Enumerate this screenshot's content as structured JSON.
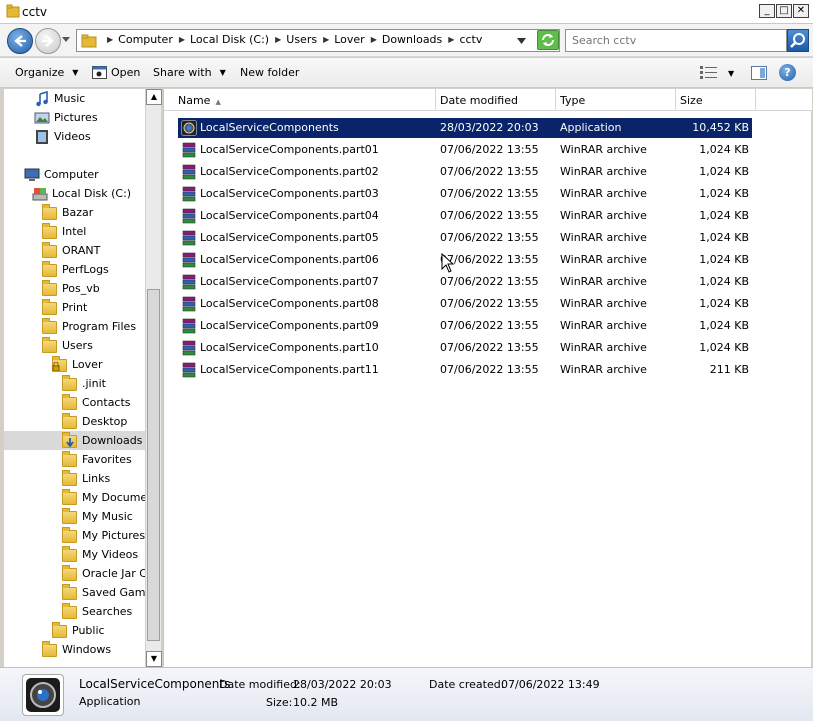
{
  "window": {
    "title": "cctv"
  },
  "address": {
    "crumbs": [
      "Computer",
      "Local Disk (C:)",
      "Users",
      "Lover",
      "Downloads",
      "cctv"
    ],
    "search_placeholder": "Search cctv"
  },
  "toolbar": {
    "organize": "Organize",
    "open": "Open",
    "share_with": "Share with",
    "new_folder": "New folder"
  },
  "nav": {
    "items": [
      {
        "label": "Music",
        "icon": "music-icon"
      },
      {
        "label": "Pictures",
        "icon": "pictures-icon"
      },
      {
        "label": "Videos",
        "icon": "videos-icon"
      },
      {
        "label": "Computer",
        "icon": "computer-icon"
      },
      {
        "label": "Local Disk (C:)",
        "icon": "drive-icon"
      },
      {
        "label": "Bazar",
        "icon": "folder-icon"
      },
      {
        "label": "Intel",
        "icon": "folder-icon"
      },
      {
        "label": "ORANT",
        "icon": "folder-icon"
      },
      {
        "label": "PerfLogs",
        "icon": "folder-icon"
      },
      {
        "label": "Pos_vb",
        "icon": "folder-icon"
      },
      {
        "label": "Print",
        "icon": "folder-icon"
      },
      {
        "label": "Program Files",
        "icon": "folder-icon"
      },
      {
        "label": "Users",
        "icon": "folder-icon"
      },
      {
        "label": "Lover",
        "icon": "user-folder-icon"
      },
      {
        "label": ".jinit",
        "icon": "folder-icon"
      },
      {
        "label": "Contacts",
        "icon": "contacts-icon"
      },
      {
        "label": "Desktop",
        "icon": "desktop-icon"
      },
      {
        "label": "Downloads",
        "icon": "downloads-icon"
      },
      {
        "label": "Favorites",
        "icon": "favorites-icon"
      },
      {
        "label": "Links",
        "icon": "links-icon"
      },
      {
        "label": "My Documen",
        "icon": "documents-icon"
      },
      {
        "label": "My Music",
        "icon": "music-icon"
      },
      {
        "label": "My Pictures",
        "icon": "pictures-icon"
      },
      {
        "label": "My Videos",
        "icon": "videos-icon"
      },
      {
        "label": "Oracle Jar C",
        "icon": "folder-icon"
      },
      {
        "label": "Saved Game",
        "icon": "saved-games-icon"
      },
      {
        "label": "Searches",
        "icon": "searches-icon"
      },
      {
        "label": "Public",
        "icon": "folder-icon"
      },
      {
        "label": "Windows",
        "icon": "folder-icon"
      }
    ]
  },
  "columns": {
    "name": "Name",
    "date": "Date modified",
    "type": "Type",
    "size": "Size"
  },
  "files": [
    {
      "name": "LocalServiceComponents",
      "date": "28/03/2022 20:03",
      "type": "Application",
      "size": "10,452 KB",
      "icon": "application-icon"
    },
    {
      "name": "LocalServiceComponents.part01",
      "date": "07/06/2022 13:55",
      "type": "WinRAR archive",
      "size": "1,024 KB",
      "icon": "winrar-icon"
    },
    {
      "name": "LocalServiceComponents.part02",
      "date": "07/06/2022 13:55",
      "type": "WinRAR archive",
      "size": "1,024 KB",
      "icon": "winrar-icon"
    },
    {
      "name": "LocalServiceComponents.part03",
      "date": "07/06/2022 13:55",
      "type": "WinRAR archive",
      "size": "1,024 KB",
      "icon": "winrar-icon"
    },
    {
      "name": "LocalServiceComponents.part04",
      "date": "07/06/2022 13:55",
      "type": "WinRAR archive",
      "size": "1,024 KB",
      "icon": "winrar-icon"
    },
    {
      "name": "LocalServiceComponents.part05",
      "date": "07/06/2022 13:55",
      "type": "WinRAR archive",
      "size": "1,024 KB",
      "icon": "winrar-icon"
    },
    {
      "name": "LocalServiceComponents.part06",
      "date": "07/06/2022 13:55",
      "type": "WinRAR archive",
      "size": "1,024 KB",
      "icon": "winrar-icon"
    },
    {
      "name": "LocalServiceComponents.part07",
      "date": "07/06/2022 13:55",
      "type": "WinRAR archive",
      "size": "1,024 KB",
      "icon": "winrar-icon"
    },
    {
      "name": "LocalServiceComponents.part08",
      "date": "07/06/2022 13:55",
      "type": "WinRAR archive",
      "size": "1,024 KB",
      "icon": "winrar-icon"
    },
    {
      "name": "LocalServiceComponents.part09",
      "date": "07/06/2022 13:55",
      "type": "WinRAR archive",
      "size": "1,024 KB",
      "icon": "winrar-icon"
    },
    {
      "name": "LocalServiceComponents.part10",
      "date": "07/06/2022 13:55",
      "type": "WinRAR archive",
      "size": "1,024 KB",
      "icon": "winrar-icon"
    },
    {
      "name": "LocalServiceComponents.part11",
      "date": "07/06/2022 13:55",
      "type": "WinRAR archive",
      "size": "211 KB",
      "icon": "winrar-icon"
    }
  ],
  "details": {
    "name": "LocalServiceComponents",
    "type": "Application",
    "modified_label": "Date modified:",
    "modified_value": "28/03/2022 20:03",
    "size_label": "Size:",
    "size_value": "10.2 MB",
    "created_label": "Date created:",
    "created_value": "07/06/2022 13:49"
  },
  "colors": {
    "selection": "#0a246a",
    "folder": "#e6b935"
  }
}
